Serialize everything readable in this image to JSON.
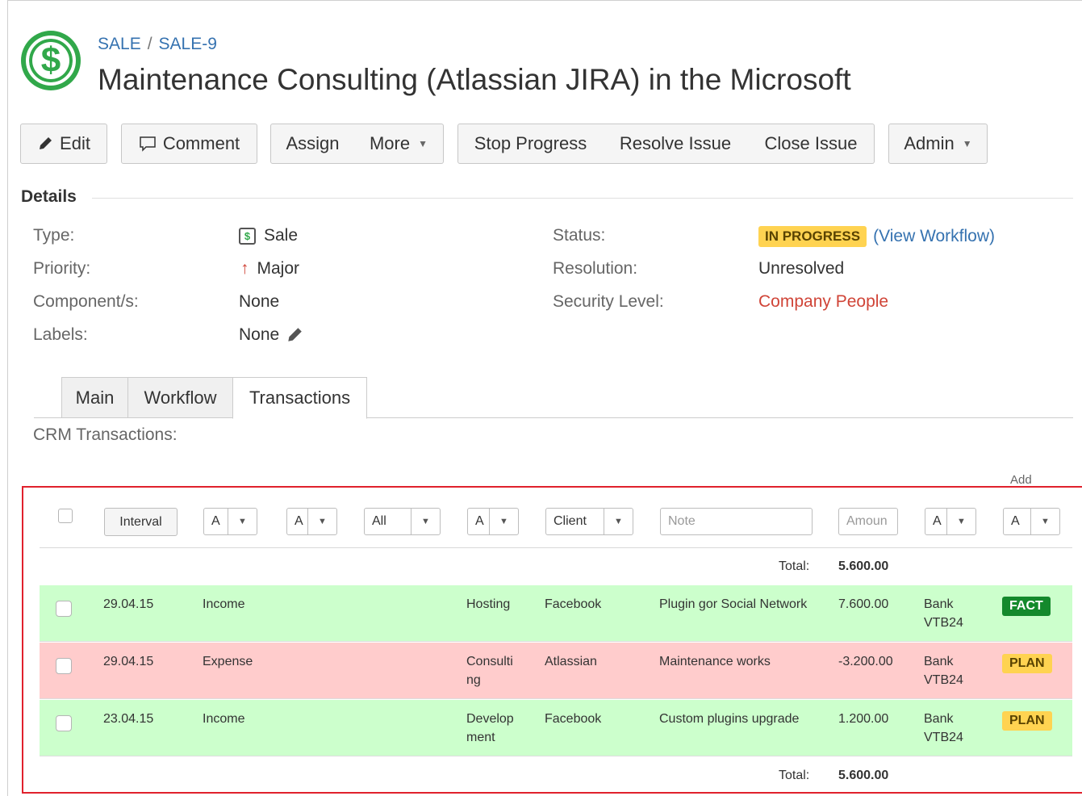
{
  "header": {
    "project_link": "SALE",
    "separator": "/",
    "issue_key": "SALE-9",
    "title": "Maintenance Consulting (Atlassian JIRA) in the Microsoft",
    "logo_symbol": "$"
  },
  "toolbar": {
    "edit": "Edit",
    "comment": "Comment",
    "assign": "Assign",
    "more": "More",
    "stop_progress": "Stop Progress",
    "resolve_issue": "Resolve Issue",
    "close_issue": "Close Issue",
    "admin": "Admin"
  },
  "details": {
    "section_title": "Details",
    "type_label": "Type:",
    "type_value": "Sale",
    "type_icon_symbol": "$",
    "priority_label": "Priority:",
    "priority_value": "Major",
    "priority_arrow": "↑",
    "components_label": "Component/s:",
    "components_value": "None",
    "labels_label": "Labels:",
    "labels_value": "None",
    "status_label": "Status:",
    "status_value": "IN PROGRESS",
    "view_workflow_open": "(",
    "view_workflow": "View Workflow",
    "view_workflow_close": ")",
    "resolution_label": "Resolution:",
    "resolution_value": "Unresolved",
    "security_label": "Security Level:",
    "security_value": "Company People"
  },
  "tabs": {
    "main": "Main",
    "workflow": "Workflow",
    "transactions": "Transactions"
  },
  "transactions": {
    "section_label": "CRM Transactions:",
    "add_link": "Add",
    "filters": {
      "interval": "Interval",
      "type_select": "A",
      "select2": "A",
      "all_select": "All",
      "category_select": "A",
      "client_select": "Client",
      "note_placeholder": "Note",
      "amount_placeholder": "Amoun",
      "account_select": "A",
      "status_select": "A"
    },
    "total_label": "Total:",
    "total_value": "5.600.00",
    "rows": [
      {
        "date": "29.04.15",
        "kind": "Income",
        "category": "Hosting",
        "client": "Facebook",
        "note": "Plugin gor Social Network",
        "amount": "7.600.00",
        "account": "Bank VTB24",
        "status": "FACT"
      },
      {
        "date": "29.04.15",
        "kind": "Expense",
        "category": "Consulting",
        "client": "Atlassian",
        "note": "Maintenance works",
        "amount": "-3.200.00",
        "account": "Bank VTB24",
        "status": "PLAN"
      },
      {
        "date": "23.04.15",
        "kind": "Income",
        "category": "Development",
        "client": "Facebook",
        "note": "Custom plugins upgrade",
        "amount": "1.200.00",
        "account": "Bank VTB24",
        "status": "PLAN"
      }
    ]
  },
  "colors": {
    "link": "#3572b0",
    "security": "#d04437",
    "income_row": "#ccffcc",
    "expense_row": "#ffcccc",
    "fact_badge": "#14892c",
    "plan_badge": "#ffd351",
    "highlight_border": "#e0212d"
  }
}
